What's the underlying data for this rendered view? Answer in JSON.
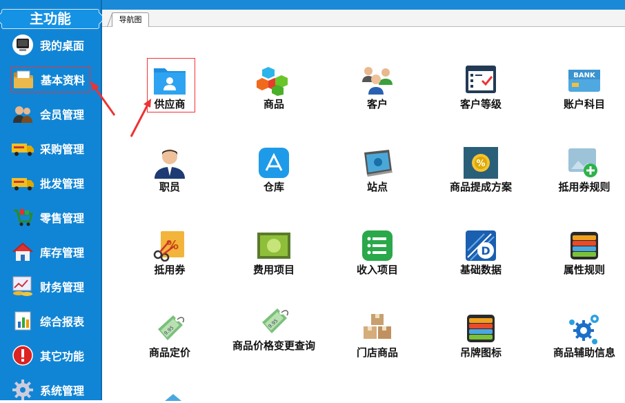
{
  "sidebar": {
    "title": "主功能",
    "items": [
      {
        "label": "我的桌面",
        "icon": "desktop-icon"
      },
      {
        "label": "基本资料",
        "icon": "folder-icon"
      },
      {
        "label": "会员管理",
        "icon": "members-icon"
      },
      {
        "label": "采购管理",
        "icon": "truck-icon"
      },
      {
        "label": "批发管理",
        "icon": "truck-icon"
      },
      {
        "label": "零售管理",
        "icon": "cart-icon"
      },
      {
        "label": "库存管理",
        "icon": "house-icon"
      },
      {
        "label": "财务管理",
        "icon": "finance-icon"
      },
      {
        "label": "综合报表",
        "icon": "report-icon"
      },
      {
        "label": "其它功能",
        "icon": "alert-icon"
      },
      {
        "label": "系统管理",
        "icon": "gear-icon"
      }
    ],
    "active_index": 1
  },
  "tabs": [
    {
      "label": "导航图"
    }
  ],
  "grid": [
    {
      "label": "供应商",
      "icon": "supplier-folder-icon"
    },
    {
      "label": "商品",
      "icon": "cubes-icon"
    },
    {
      "label": "客户",
      "icon": "customers-icon"
    },
    {
      "label": "客户等级",
      "icon": "checklist-icon"
    },
    {
      "label": "账户科目",
      "icon": "bank-card-icon"
    },
    {
      "label": "职员",
      "icon": "employee-icon"
    },
    {
      "label": "仓库",
      "icon": "app-store-icon"
    },
    {
      "label": "站点",
      "icon": "station-icon"
    },
    {
      "label": "商品提成方案",
      "icon": "commission-icon"
    },
    {
      "label": "抵用券规则",
      "icon": "image-add-icon"
    },
    {
      "label": "抵用券",
      "icon": "coupon-icon"
    },
    {
      "label": "费用项目",
      "icon": "expense-icon"
    },
    {
      "label": "收入项目",
      "icon": "list-icon"
    },
    {
      "label": "基础数据",
      "icon": "base-data-icon"
    },
    {
      "label": "属性规则",
      "icon": "layers-icon"
    },
    {
      "label": "商品定价",
      "icon": "price-tag-icon"
    },
    {
      "label": "商品价格变更查询",
      "icon": "price-tag-icon"
    },
    {
      "label": "门店商品",
      "icon": "boxes-icon"
    },
    {
      "label": "吊牌图标",
      "icon": "layers-icon"
    },
    {
      "label": "商品辅助信息",
      "icon": "gears-icon"
    }
  ],
  "colors": {
    "sidebar": "#1185d5",
    "highlight": "#e33333"
  }
}
